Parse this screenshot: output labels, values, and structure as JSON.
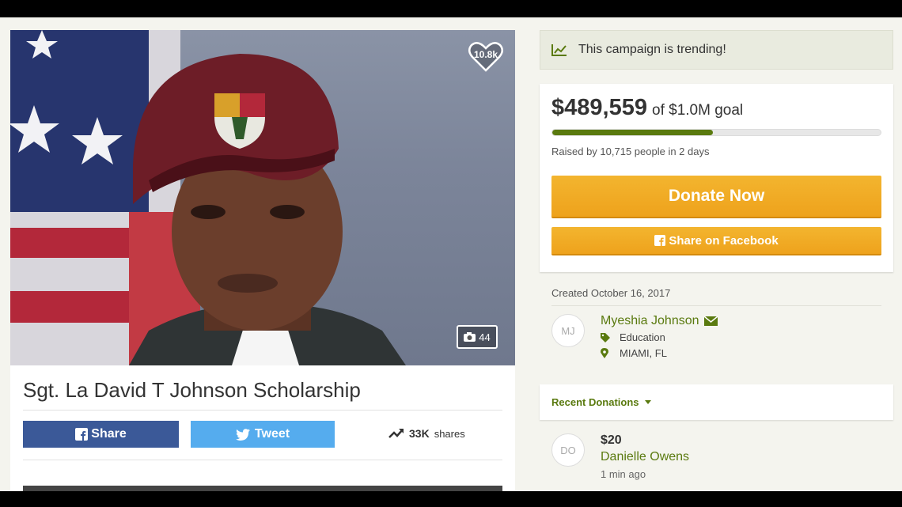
{
  "trending": {
    "text": "This campaign is trending!"
  },
  "photo": {
    "likes": "10.8k",
    "photo_count": "44"
  },
  "campaign": {
    "title": "Sgt. La David T Johnson Scholarship"
  },
  "share_bar": {
    "facebook_label": "Share",
    "twitter_label": "Tweet",
    "shares_count": "33K",
    "shares_label": "shares"
  },
  "goal": {
    "amount": "$489,559",
    "goal_text": "of $1.0M goal",
    "progress_fraction": 0.49,
    "raised_text": "Raised by 10,715 people in 2 days",
    "donate_label": "Donate Now",
    "share_facebook_label": "Share on Facebook"
  },
  "organizer": {
    "created": "Created October 16, 2017",
    "initials": "MJ",
    "name": "Myeshia Johnson",
    "category": "Education",
    "location": "MIAMI, FL"
  },
  "donations": {
    "header": "Recent Donations",
    "items": [
      {
        "initials": "DO",
        "amount": "$20",
        "name": "Danielle Owens",
        "time": "1 min ago"
      }
    ]
  },
  "colors": {
    "accent_green": "#5a7a0f",
    "donate_orange": "#f0a824",
    "facebook_blue": "#3b5998",
    "twitter_blue": "#55acee"
  }
}
